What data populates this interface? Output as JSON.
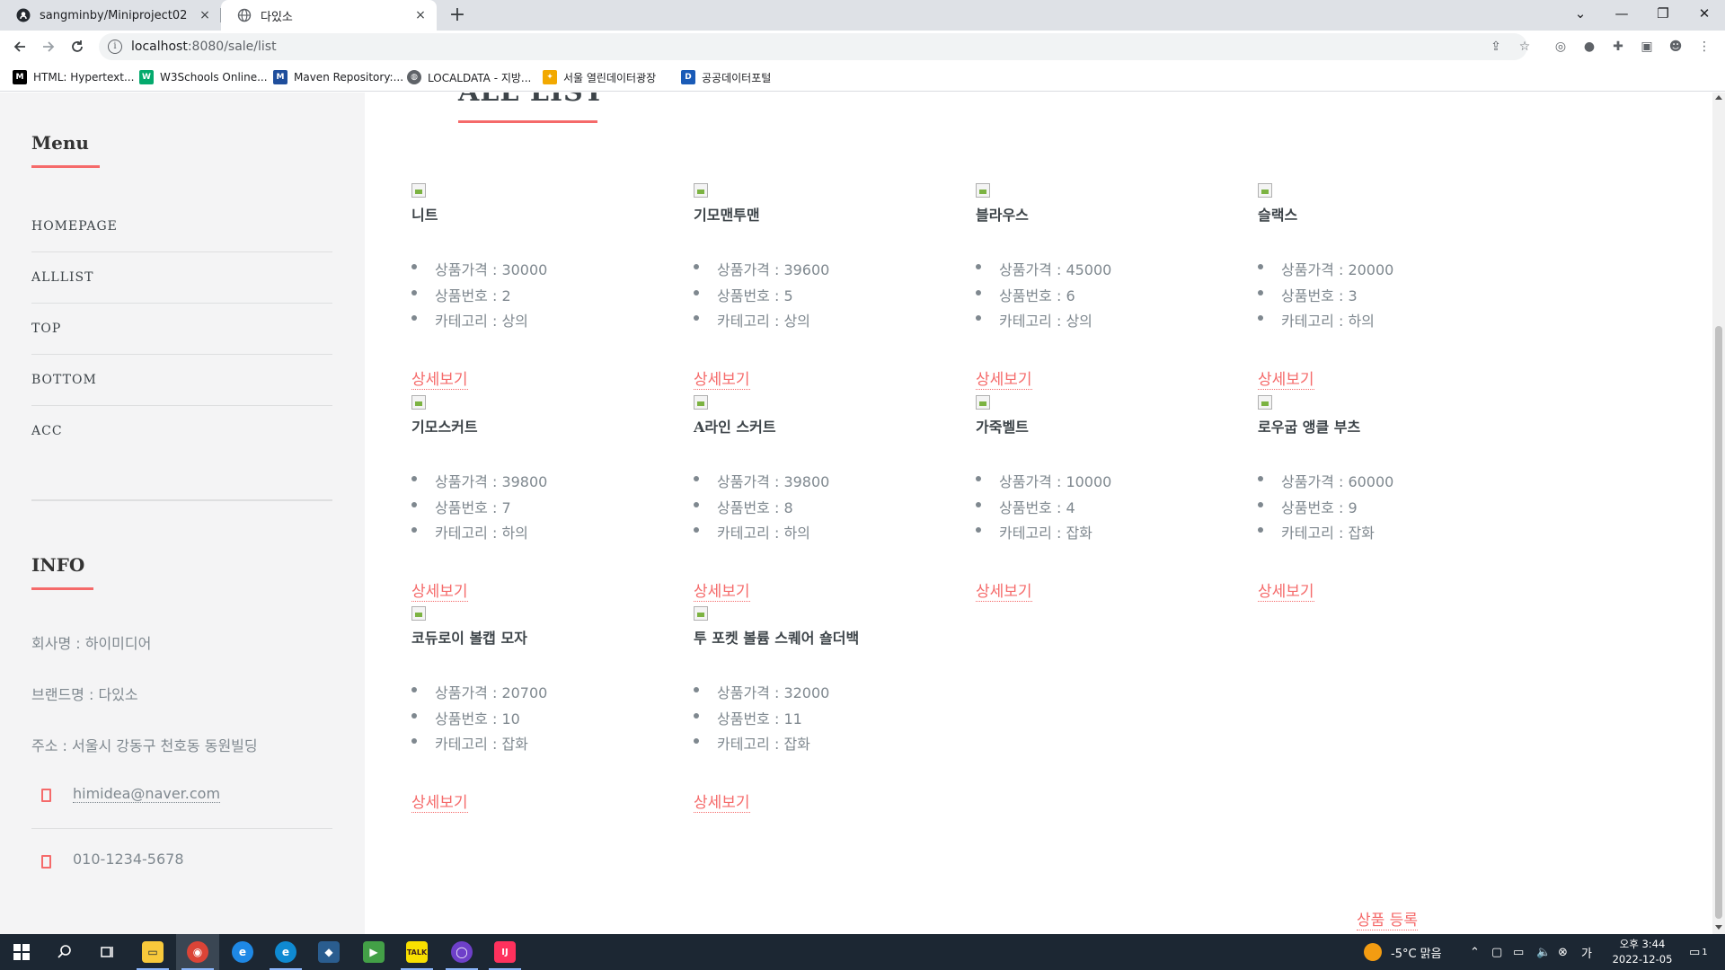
{
  "browser": {
    "tabs": [
      {
        "title": "sangminby/Miniproject02",
        "close": "×"
      },
      {
        "title": "다있소",
        "close": "×"
      }
    ],
    "new_tab": "+",
    "window_controls": {
      "minimize": "—",
      "restore": "❐",
      "close": "✕",
      "tab_search": "⌄"
    },
    "url_host": "localhost",
    "url_path": ":8080/sale/list",
    "bookmarks": [
      {
        "label": "HTML: Hypertext...",
        "icon": "mdn-icon",
        "color": "#000000",
        "glyph": "M"
      },
      {
        "label": "W3Schools Online...",
        "icon": "w3schools-icon",
        "color": "#04aa6d",
        "glyph": "W"
      },
      {
        "label": "Maven Repository:...",
        "icon": "maven-icon",
        "color": "#1f4e9c",
        "glyph": "M"
      },
      {
        "label": "LOCALDATA - 지방...",
        "icon": "localdata-icon",
        "color": "#5f6368",
        "glyph": "◍"
      },
      {
        "label": "서울 열린데이터광장",
        "icon": "seoul-data-icon",
        "color": "#f2a900",
        "glyph": "✦"
      },
      {
        "label": "공공데이터포털",
        "icon": "data-portal-icon",
        "color": "#1a5bb7",
        "glyph": "D"
      }
    ]
  },
  "sidebar": {
    "menu_heading": "Menu",
    "menu_items": [
      "HOMEPAGE",
      "ALLLIST",
      "TOP",
      "BOTTOM",
      "ACC"
    ],
    "info_heading": "INFO",
    "info_lines": [
      "회사명 : 하이미디어",
      "브랜드명 : 다있소",
      "주소 : 서울시 강동구 천호동 동원빌딩"
    ],
    "email": "himidea@naver.com",
    "phone": "010-1234-5678"
  },
  "main": {
    "title": "ALL LIST",
    "detail_label": "상세보기",
    "register_label": "상품 등록",
    "products": [
      {
        "name": "니트",
        "price": "상품가격 : 30000",
        "no": "상품번호 : 2",
        "category": "카테고리 : 상의"
      },
      {
        "name": "기모맨투맨",
        "price": "상품가격 : 39600",
        "no": "상품번호 : 5",
        "category": "카테고리 : 상의"
      },
      {
        "name": "블라우스",
        "price": "상품가격 : 45000",
        "no": "상품번호 : 6",
        "category": "카테고리 : 상의"
      },
      {
        "name": "슬랙스",
        "price": "상품가격 : 20000",
        "no": "상품번호 : 3",
        "category": "카테고리 : 하의"
      },
      {
        "name": "기모스커트",
        "price": "상품가격 : 39800",
        "no": "상품번호 : 7",
        "category": "카테고리 : 하의"
      },
      {
        "name": "A라인 스커트",
        "price": "상품가격 : 39800",
        "no": "상품번호 : 8",
        "category": "카테고리 : 하의"
      },
      {
        "name": "가죽벨트",
        "price": "상품가격 : 10000",
        "no": "상품번호 : 4",
        "category": "카테고리 : 잡화"
      },
      {
        "name": "로우굽 앵클 부츠",
        "price": "상품가격 : 60000",
        "no": "상품번호 : 9",
        "category": "카테고리 : 잡화"
      },
      {
        "name": "코듀로이 볼캡 모자",
        "price": "상품가격 : 20700",
        "no": "상품번호 : 10",
        "category": "카테고리 : 잡화"
      },
      {
        "name": "투 포켓 볼륨 스퀘어 숄더백",
        "price": "상품가격 : 32000",
        "no": "상품번호 : 11",
        "category": "카테고리 : 잡화"
      }
    ]
  },
  "taskbar": {
    "weather": "-5°C  맑음",
    "time": "오후 3:44",
    "date": "2022-12-05",
    "notification_count": "1",
    "apps": [
      {
        "name": "file-explorer-icon",
        "color": "#f8c93b",
        "glyph": "▭",
        "active": false
      },
      {
        "name": "chrome-icon",
        "color": "#db4437",
        "glyph": "◉",
        "active": true
      },
      {
        "name": "internet-explorer-icon",
        "color": "#1e88e5",
        "glyph": "e",
        "active": false
      },
      {
        "name": "edge-icon",
        "color": "#0f8ad2",
        "glyph": "e",
        "active": false
      },
      {
        "name": "mysql-workbench-icon",
        "color": "#2a5d8f",
        "glyph": "◆",
        "active": false
      },
      {
        "name": "media-app-icon",
        "color": "#43a047",
        "glyph": "▶",
        "active": false
      },
      {
        "name": "kakaotalk-icon",
        "color": "#f9e000",
        "glyph": "TALK",
        "active": false
      },
      {
        "name": "github-desktop-icon",
        "color": "#6e40c9",
        "glyph": "◯",
        "active": false
      },
      {
        "name": "intellij-icon",
        "color": "#fe315d",
        "glyph": "IJ",
        "active": false
      }
    ]
  },
  "colors": {
    "accent": "#f56a6a",
    "sidebar_bg": "#f4f4f5",
    "text": "#3d4449",
    "muted": "#7f888f"
  }
}
